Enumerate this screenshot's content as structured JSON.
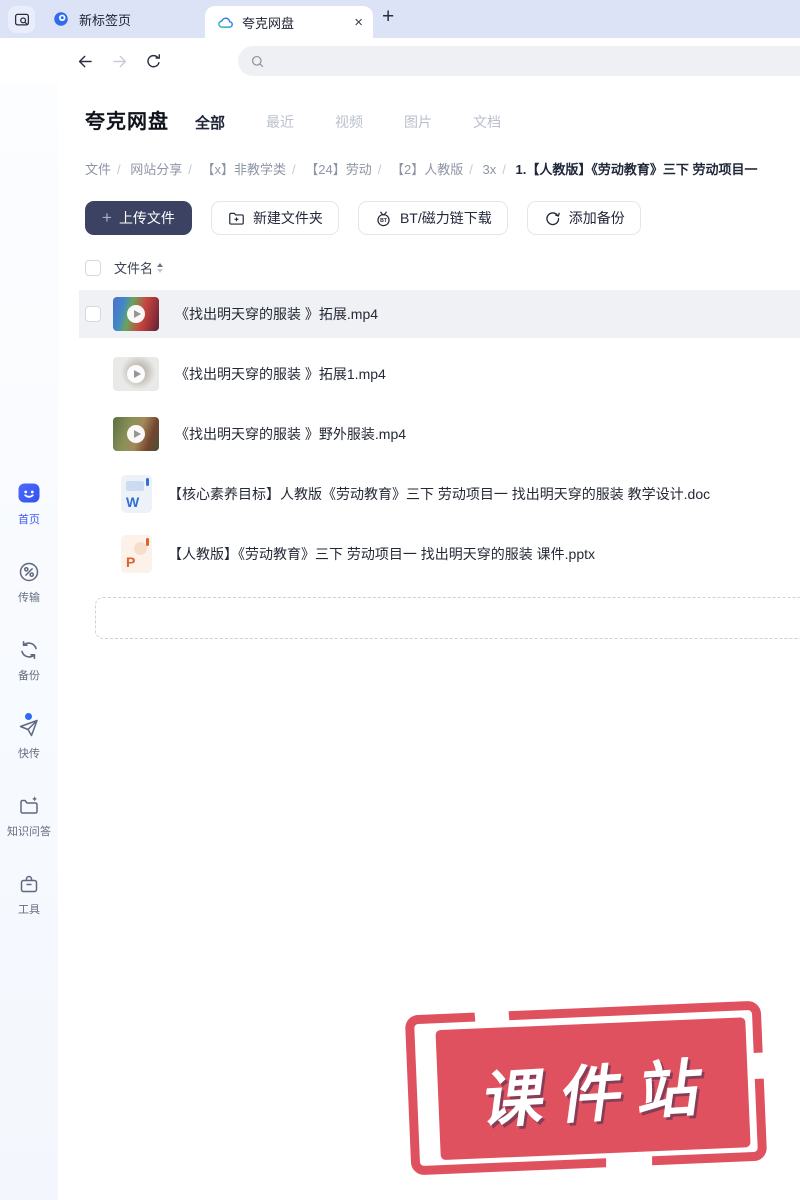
{
  "browser": {
    "tab_new_label": "新标签页",
    "tab_active_label": "夸克网盘",
    "close_glyph": "×",
    "new_tab_glyph": "+"
  },
  "drive": {
    "title": "夸克网盘",
    "tabs": [
      "全部",
      "最近",
      "视频",
      "图片",
      "文档"
    ],
    "breadcrumb": {
      "separator": "/",
      "items": [
        "文件",
        "网站分享",
        "【x】非教学类",
        "【24】劳动",
        "【2】人教版",
        "3x",
        "1.【人教版】《劳动教育》三下 劳动项目一"
      ]
    },
    "actions": {
      "upload_plus": "+",
      "upload": "上传文件",
      "new_folder": "新建文件夹",
      "bt_download": "BT/磁力链下载",
      "add_backup": "添加备份"
    },
    "table": {
      "name_header": "文件名"
    },
    "files": [
      {
        "name": "《找出明天穿的服装 》拓展.mp4",
        "type": "video"
      },
      {
        "name": "《找出明天穿的服装 》拓展1.mp4",
        "type": "video"
      },
      {
        "name": "《找出明天穿的服装 》野外服装.mp4",
        "type": "video"
      },
      {
        "name": "【核心素养目标】人教版《劳动教育》三下 劳动项目一 找出明天穿的服装  教学设计.doc",
        "type": "doc",
        "badge": "W"
      },
      {
        "name": "【人教版】《劳动教育》三下 劳动项目一 找出明天穿的服装  课件.pptx",
        "type": "ppt",
        "badge": "P"
      }
    ],
    "sidebar": [
      {
        "label": "首页",
        "active": true
      },
      {
        "label": "传输"
      },
      {
        "label": "备份"
      },
      {
        "label": "快传"
      },
      {
        "label": "知识问答"
      },
      {
        "label": "工具"
      }
    ],
    "stamp": "课件站",
    "colors": {
      "accent_blue": "#3f5bf6",
      "primary_button": "#3b4262",
      "tabbar_lavender": "#dde3f7",
      "stamp_red": "#e0515f"
    }
  }
}
